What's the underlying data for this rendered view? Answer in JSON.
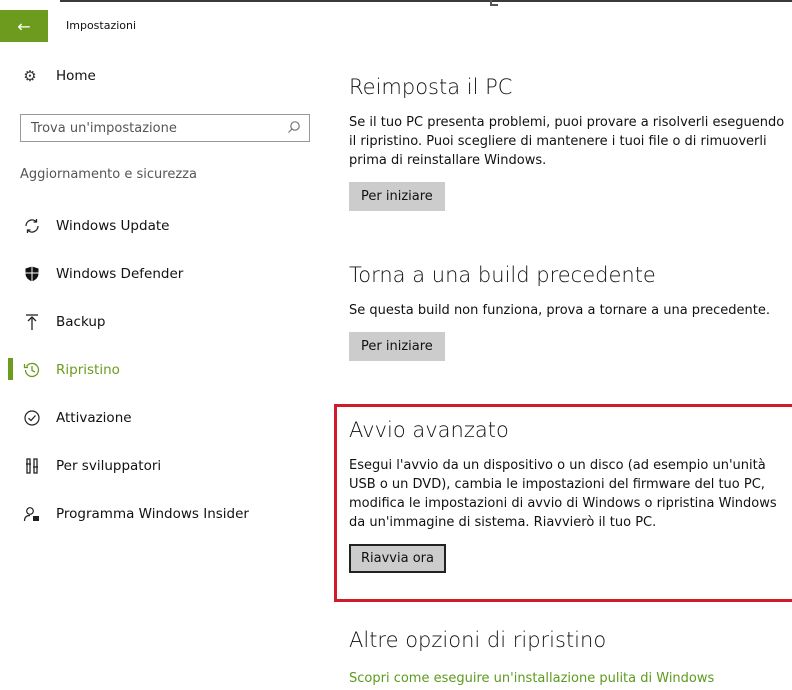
{
  "window": {
    "title": "Impostazioni",
    "back_icon": "arrow-left-icon",
    "accent": "#6c9b1e"
  },
  "sidebar": {
    "home_label": "Home",
    "search_placeholder": "Trova un'impostazione",
    "section_label": "Aggiornamento e sicurezza",
    "items": [
      {
        "label": "Windows Update",
        "icon": "refresh-icon"
      },
      {
        "label": "Windows Defender",
        "icon": "shield-icon"
      },
      {
        "label": "Backup",
        "icon": "upload-icon"
      },
      {
        "label": "Ripristino",
        "icon": "history-icon",
        "active": true
      },
      {
        "label": "Attivazione",
        "icon": "check-circle-icon"
      },
      {
        "label": "Per sviluppatori",
        "icon": "tools-icon"
      },
      {
        "label": "Programma Windows Insider",
        "icon": "person-badge-icon"
      }
    ]
  },
  "main": {
    "reset": {
      "title": "Reimposta il PC",
      "description": "Se il tuo PC presenta problemi, puoi provare a risolverli eseguendo il ripristino. Puoi scegliere di mantenere i tuoi file o di rimuoverli prima di reinstallare Windows.",
      "button": "Per iniziare"
    },
    "rollback": {
      "title": "Torna a una build precedente",
      "description": "Se questa build non funziona, prova a tornare a una precedente.",
      "button": "Per iniziare"
    },
    "advanced": {
      "title": "Avvio avanzato",
      "description": "Esegui l'avvio da un dispositivo o un disco (ad esempio un'unità USB o un DVD), cambia le impostazioni del firmware del tuo PC, modifica le impostazioni di avvio di Windows o ripristina Windows da un'immagine di sistema. Riavvierò il tuo PC.",
      "button": "Riavvia ora",
      "highlight_color": "#d11a2a"
    },
    "more": {
      "title": "Altre opzioni di ripristino",
      "link": "Scopri come eseguire un'installazione pulita di Windows"
    }
  }
}
